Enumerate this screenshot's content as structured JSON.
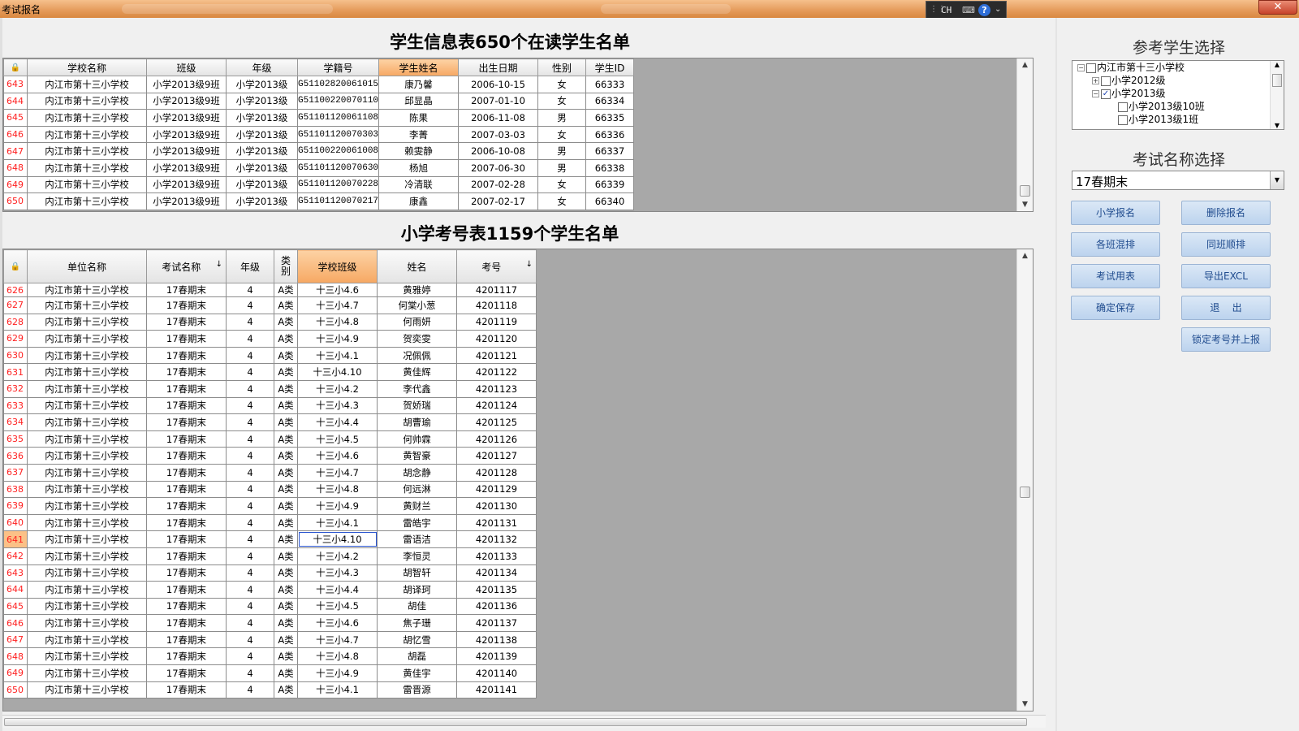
{
  "window": {
    "title": "考试报名",
    "close_glyph": "✕"
  },
  "ime": {
    "grip": "⋮⋮",
    "lang": "CH",
    "keyboard_glyph": "⌨",
    "help": "?",
    "more": "⌄"
  },
  "student_table": {
    "heading": "学生信息表650个在读学生名单",
    "corner": "🔒",
    "columns": [
      "学校名称",
      "班级",
      "年级",
      "学籍号",
      "学生姓名",
      "出生日期",
      "性别",
      "学生ID"
    ],
    "highlight_column": 4,
    "rows": [
      {
        "rn": "643",
        "cells": [
          "内江市第十三小学校",
          "小学2013级9班",
          "小学2013级",
          "G51102820061015",
          "康乃馨",
          "2006-10-15",
          "女",
          "66333"
        ]
      },
      {
        "rn": "644",
        "cells": [
          "内江市第十三小学校",
          "小学2013级9班",
          "小学2013级",
          "G51100220070110",
          "邱显晶",
          "2007-01-10",
          "女",
          "66334"
        ]
      },
      {
        "rn": "645",
        "cells": [
          "内江市第十三小学校",
          "小学2013级9班",
          "小学2013级",
          "G51101120061108",
          "陈果",
          "2006-11-08",
          "男",
          "66335"
        ]
      },
      {
        "rn": "646",
        "cells": [
          "内江市第十三小学校",
          "小学2013级9班",
          "小学2013级",
          "G51101120070303",
          "李菁",
          "2007-03-03",
          "女",
          "66336"
        ]
      },
      {
        "rn": "647",
        "cells": [
          "内江市第十三小学校",
          "小学2013级9班",
          "小学2013级",
          "G51100220061008",
          "赖雯静",
          "2006-10-08",
          "男",
          "66337"
        ]
      },
      {
        "rn": "648",
        "cells": [
          "内江市第十三小学校",
          "小学2013级9班",
          "小学2013级",
          "G51101120070630",
          "杨旭",
          "2007-06-30",
          "男",
          "66338"
        ]
      },
      {
        "rn": "649",
        "cells": [
          "内江市第十三小学校",
          "小学2013级9班",
          "小学2013级",
          "G51101120070228",
          "冷清联",
          "2007-02-28",
          "女",
          "66339"
        ]
      },
      {
        "rn": "650",
        "cells": [
          "内江市第十三小学校",
          "小学2013级9班",
          "小学2013级",
          "G51101120070217",
          "康鑫",
          "2007-02-17",
          "女",
          "66340"
        ]
      }
    ]
  },
  "exam_table": {
    "heading": "小学考号表1159个学生名单",
    "corner": "🔒",
    "columns": [
      "单位名称",
      "考试名称",
      "年级",
      "类别",
      "学校班级",
      "姓名",
      "考号"
    ],
    "sort_arrow": "↓",
    "sorted_columns": [
      1,
      6
    ],
    "highlight_column": 4,
    "selected_row": "641",
    "rows": [
      {
        "rn": "626",
        "cells": [
          "内江市第十三小学校",
          "17春期末",
          "4",
          "A类",
          "十三小4.6",
          "黄雅婷",
          "4201117"
        ]
      },
      {
        "rn": "627",
        "cells": [
          "内江市第十三小学校",
          "17春期末",
          "4",
          "A类",
          "十三小4.7",
          "何棠小葱",
          "4201118"
        ]
      },
      {
        "rn": "628",
        "cells": [
          "内江市第十三小学校",
          "17春期末",
          "4",
          "A类",
          "十三小4.8",
          "何雨妍",
          "4201119"
        ]
      },
      {
        "rn": "629",
        "cells": [
          "内江市第十三小学校",
          "17春期末",
          "4",
          "A类",
          "十三小4.9",
          "贺奕雯",
          "4201120"
        ]
      },
      {
        "rn": "630",
        "cells": [
          "内江市第十三小学校",
          "17春期末",
          "4",
          "A类",
          "十三小4.1",
          "况佩佩",
          "4201121"
        ]
      },
      {
        "rn": "631",
        "cells": [
          "内江市第十三小学校",
          "17春期末",
          "4",
          "A类",
          "十三小4.10",
          "黄佳辉",
          "4201122"
        ]
      },
      {
        "rn": "632",
        "cells": [
          "内江市第十三小学校",
          "17春期末",
          "4",
          "A类",
          "十三小4.2",
          "李代鑫",
          "4201123"
        ]
      },
      {
        "rn": "633",
        "cells": [
          "内江市第十三小学校",
          "17春期末",
          "4",
          "A类",
          "十三小4.3",
          "贺娇瑞",
          "4201124"
        ]
      },
      {
        "rn": "634",
        "cells": [
          "内江市第十三小学校",
          "17春期末",
          "4",
          "A类",
          "十三小4.4",
          "胡曹瑜",
          "4201125"
        ]
      },
      {
        "rn": "635",
        "cells": [
          "内江市第十三小学校",
          "17春期末",
          "4",
          "A类",
          "十三小4.5",
          "何帅霖",
          "4201126"
        ]
      },
      {
        "rn": "636",
        "cells": [
          "内江市第十三小学校",
          "17春期末",
          "4",
          "A类",
          "十三小4.6",
          "黄智豪",
          "4201127"
        ]
      },
      {
        "rn": "637",
        "cells": [
          "内江市第十三小学校",
          "17春期末",
          "4",
          "A类",
          "十三小4.7",
          "胡念静",
          "4201128"
        ]
      },
      {
        "rn": "638",
        "cells": [
          "内江市第十三小学校",
          "17春期末",
          "4",
          "A类",
          "十三小4.8",
          "何远淋",
          "4201129"
        ]
      },
      {
        "rn": "639",
        "cells": [
          "内江市第十三小学校",
          "17春期末",
          "4",
          "A类",
          "十三小4.9",
          "黄财兰",
          "4201130"
        ]
      },
      {
        "rn": "640",
        "cells": [
          "内江市第十三小学校",
          "17春期末",
          "4",
          "A类",
          "十三小4.1",
          "雷皓宇",
          "4201131"
        ]
      },
      {
        "rn": "641",
        "cells": [
          "内江市第十三小学校",
          "17春期末",
          "4",
          "A类",
          "十三小4.10",
          "雷语洁",
          "4201132"
        ]
      },
      {
        "rn": "642",
        "cells": [
          "内江市第十三小学校",
          "17春期末",
          "4",
          "A类",
          "十三小4.2",
          "李恒灵",
          "4201133"
        ]
      },
      {
        "rn": "643",
        "cells": [
          "内江市第十三小学校",
          "17春期末",
          "4",
          "A类",
          "十三小4.3",
          "胡智轩",
          "4201134"
        ]
      },
      {
        "rn": "644",
        "cells": [
          "内江市第十三小学校",
          "17春期末",
          "4",
          "A类",
          "十三小4.4",
          "胡译珂",
          "4201135"
        ]
      },
      {
        "rn": "645",
        "cells": [
          "内江市第十三小学校",
          "17春期末",
          "4",
          "A类",
          "十三小4.5",
          "胡佳",
          "4201136"
        ]
      },
      {
        "rn": "646",
        "cells": [
          "内江市第十三小学校",
          "17春期末",
          "4",
          "A类",
          "十三小4.6",
          "焦子珊",
          "4201137"
        ]
      },
      {
        "rn": "647",
        "cells": [
          "内江市第十三小学校",
          "17春期末",
          "4",
          "A类",
          "十三小4.7",
          "胡忆雪",
          "4201138"
        ]
      },
      {
        "rn": "648",
        "cells": [
          "内江市第十三小学校",
          "17春期末",
          "4",
          "A类",
          "十三小4.8",
          "胡磊",
          "4201139"
        ]
      },
      {
        "rn": "649",
        "cells": [
          "内江市第十三小学校",
          "17春期末",
          "4",
          "A类",
          "十三小4.9",
          "黄佳宇",
          "4201140"
        ]
      },
      {
        "rn": "650",
        "cells": [
          "内江市第十三小学校",
          "17春期末",
          "4",
          "A类",
          "十三小4.1",
          "雷晋源",
          "4201141"
        ]
      }
    ]
  },
  "right_panel": {
    "student_select_title": "参考学生选择",
    "tree": [
      {
        "label": "内江市第十三小学校",
        "expander": "−",
        "checked": false
      },
      {
        "label": "小学2012级",
        "expander": "+",
        "checked": false
      },
      {
        "label": "小学2013级",
        "expander": "−",
        "checked": true
      },
      {
        "label": "小学2013级10班",
        "expander": "",
        "checked": false
      },
      {
        "label": "小学2013级1班",
        "expander": "",
        "checked": false
      }
    ],
    "exam_select_title": "考试名称选择",
    "exam_selected": "17春期末",
    "buttons": {
      "register": "小学报名",
      "delete": "删除报名",
      "mix": "各班混排",
      "same_class": "同班顺排",
      "exam_table": "考试用表",
      "export": "导出EXCL",
      "save": "确定保存",
      "exit": "退    出",
      "lock_upload": "锁定考号并上报"
    }
  },
  "colors": {
    "titlebar": "#e49a5a",
    "header_highlight": "#f6a863",
    "row_number": "#ff2020",
    "button": "#bcd3ee"
  },
  "icons": [
    "lock-icon",
    "help-icon",
    "keyboard-icon",
    "close-icon",
    "chevron-down-icon",
    "tree-expand-icon",
    "checkbox-icon"
  ]
}
